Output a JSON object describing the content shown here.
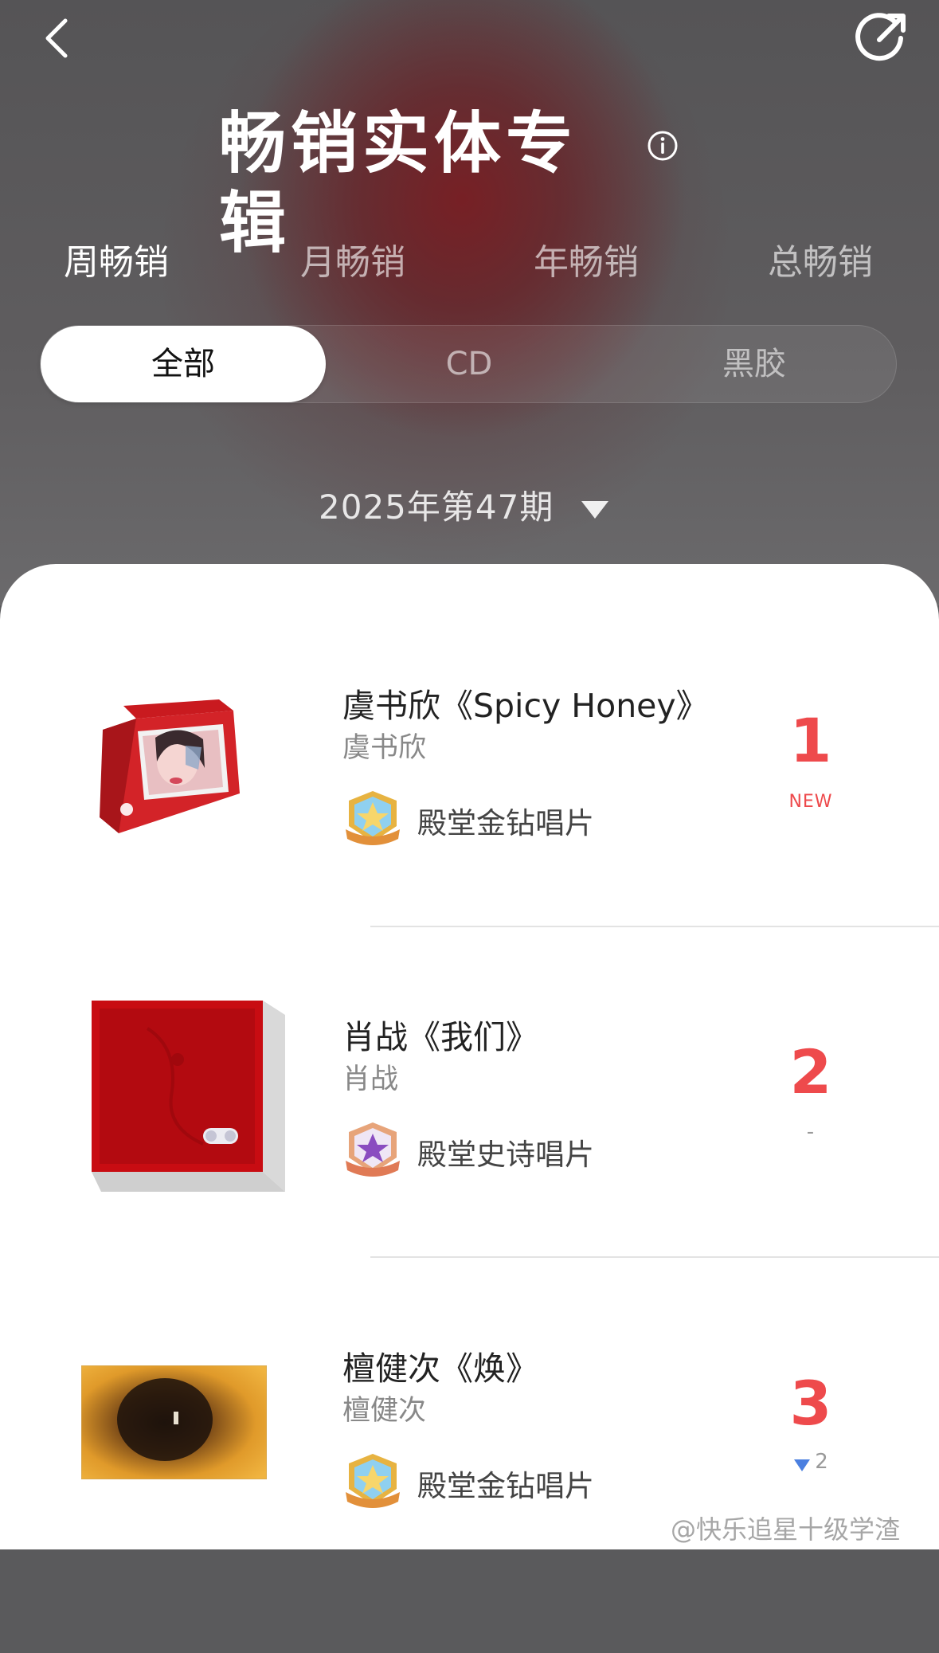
{
  "header": {
    "title": "畅销实体专辑",
    "info_icon": "info-circle-icon",
    "back_icon": "chevron-left-icon",
    "share_icon": "share-icon"
  },
  "tabs": [
    {
      "label": "周畅销",
      "active": true
    },
    {
      "label": "月畅销",
      "active": false
    },
    {
      "label": "年畅销",
      "active": false
    },
    {
      "label": "总畅销",
      "active": false
    }
  ],
  "filters": [
    {
      "label": "全部",
      "active": true
    },
    {
      "label": "CD",
      "active": false
    },
    {
      "label": "黑胶",
      "active": false
    }
  ],
  "period": {
    "label": "2025年第47期",
    "icon": "triangle-down-icon"
  },
  "chart": [
    {
      "rank": "1",
      "change": "NEW",
      "title": "虞书欣《Spicy Honey》",
      "artist": "虞书欣",
      "badge": "殿堂金钻唱片",
      "badge_icon": "gold-diamond-badge-icon"
    },
    {
      "rank": "2",
      "change": "-",
      "title": "肖战《我们》",
      "artist": "肖战",
      "badge": "殿堂史诗唱片",
      "badge_icon": "epic-badge-icon"
    },
    {
      "rank": "3",
      "change": "2",
      "change_icon": "triangle-down-icon",
      "title": "檀健次《焕》",
      "artist": "檀健次",
      "badge": "殿堂金钻唱片",
      "badge_icon": "gold-diamond-badge-icon"
    }
  ],
  "colors": {
    "rank": "#ee4a4c",
    "down_arrow": "#4a7fe0"
  },
  "watermark": "@快乐追星十级学渣"
}
